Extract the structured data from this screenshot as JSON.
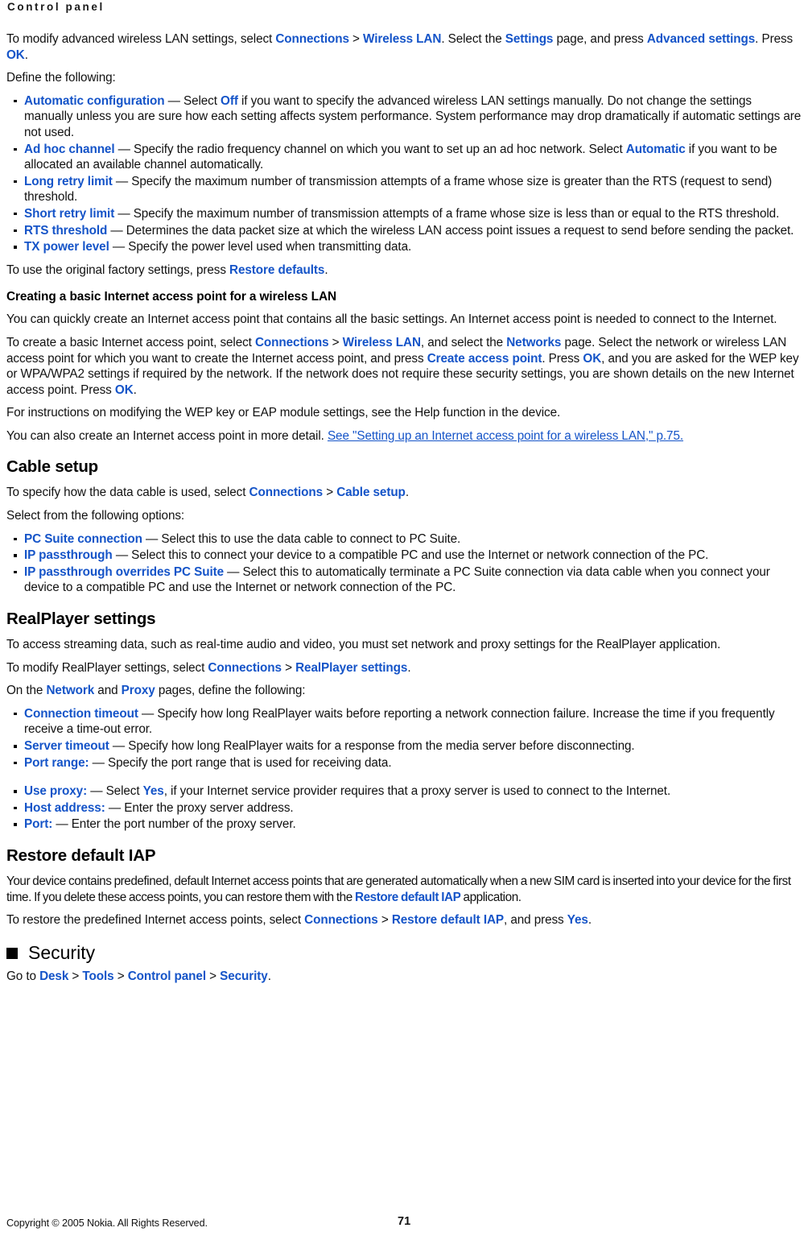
{
  "header": {
    "running_title": "Control panel"
  },
  "footer": {
    "copyright": "Copyright © 2005 Nokia. All Rights Reserved.",
    "page_number": "71"
  },
  "colors": {
    "ui_link": "#1554c8",
    "text": "#111111",
    "background": "#ffffff"
  },
  "content": {
    "intro": {
      "p1_a": "To modify advanced wireless LAN settings, select ",
      "p1_ui1": "Connections",
      "p1_b": " > ",
      "p1_ui2": "Wireless LAN",
      "p1_c": ". Select the ",
      "p1_ui3": "Settings",
      "p1_d": " page, and press ",
      "p1_ui4": "Advanced settings",
      "p1_e": ". Press ",
      "p1_ui5": "OK",
      "p1_f": ".",
      "p2": "Define the following:"
    },
    "wlan_bullets": [
      {
        "term": "Automatic configuration",
        "dash": " — ",
        "desc_a": "Select ",
        "ui": "Off",
        "desc_b": " if you want to specify the advanced wireless LAN settings manually. Do not change the settings manually unless you are sure how each setting affects system performance. System performance may drop dramatically if automatic settings are not used."
      },
      {
        "term": "Ad hoc channel",
        "dash": " — ",
        "desc_a": "Specify the radio frequency channel on which you want to set up an ad hoc network. Select ",
        "ui": "Automatic",
        "desc_b": " if you want to be allocated an available channel automatically."
      },
      {
        "term": "Long retry limit",
        "dash": " — ",
        "desc_a": "Specify the maximum number of transmission attempts of a frame whose size is greater than the RTS (request to send) threshold.",
        "ui": "",
        "desc_b": ""
      },
      {
        "term": "Short retry limit",
        "dash": " — ",
        "desc_a": "Specify the maximum number of transmission attempts of a frame whose size is less than or equal to the RTS threshold.",
        "ui": "",
        "desc_b": ""
      },
      {
        "term": "RTS threshold",
        "dash": " — ",
        "desc_a": "Determines the data packet size at which the wireless LAN access point issues a request to send before sending the packet.",
        "ui": "",
        "desc_b": ""
      },
      {
        "term": "TX power level",
        "dash": " — ",
        "desc_a": "Specify the power level used when transmitting data.",
        "ui": "",
        "desc_b": ""
      }
    ],
    "restore_defaults": {
      "a": "To use the original factory settings, press ",
      "ui": "Restore defaults",
      "b": "."
    },
    "basic_iap": {
      "heading": "Creating a basic Internet access point for a wireless LAN",
      "p1": "You can quickly create an Internet access point that contains all the basic settings. An Internet access point is needed to connect to the Internet.",
      "p2_a": "To create a basic Internet access point, select ",
      "p2_ui1": "Connections",
      "p2_b": " > ",
      "p2_ui2": "Wireless LAN",
      "p2_c": ", and select the ",
      "p2_ui3": "Networks",
      "p2_d": " page. Select the network or wireless LAN access point for which you want to create the Internet access point, and press ",
      "p2_ui4": "Create access point",
      "p2_e": ". Press ",
      "p2_ui5": "OK",
      "p2_f": ", and you are asked for the WEP key or WPA/WPA2 settings if required by the network. If the network does not require these security settings, you are shown details on the new Internet access point. Press ",
      "p2_ui6": "OK",
      "p2_g": ".",
      "p3": "For instructions on modifying the WEP key or EAP module settings, see the Help function in the device.",
      "p4_a": "You can also create an Internet access point in more detail. ",
      "p4_xref": "See \"Setting up an Internet access point for a wireless LAN,\" p.75."
    },
    "cable_setup": {
      "heading": "Cable setup",
      "p1_a": "To specify how the data cable is used, select ",
      "p1_ui1": "Connections",
      "p1_b": " > ",
      "p1_ui2": "Cable setup",
      "p1_c": ".",
      "p2": "Select from the following options:",
      "bullets": [
        {
          "term": "PC Suite connection",
          "dash": " — ",
          "desc": "Select this to use the data cable to connect to PC Suite."
        },
        {
          "term": "IP passthrough",
          "dash": " — ",
          "desc": "Select this to connect your device to a compatible PC and use the Internet or network connection of the PC."
        },
        {
          "term": "IP passthrough overrides PC Suite",
          "dash": " — ",
          "desc": "Select this to automatically terminate a PC Suite connection via data cable when you connect your device to a compatible PC and use the Internet or network connection of the PC."
        }
      ]
    },
    "realplayer": {
      "heading": "RealPlayer settings",
      "p1": "To access streaming data, such as real-time audio and video, you must set network and proxy settings for the RealPlayer application.",
      "p2_a": "To modify RealPlayer settings, select ",
      "p2_ui1": "Connections",
      "p2_b": " > ",
      "p2_ui2": "RealPlayer settings",
      "p2_c": ".",
      "p3_a": "On the ",
      "p3_ui1": "Network",
      "p3_b": " and ",
      "p3_ui2": "Proxy",
      "p3_c": " pages, define the following:",
      "network_bullets": [
        {
          "term": "Connection timeout",
          "dash": " — ",
          "desc_a": "Specify how long RealPlayer waits before reporting a network connection failure. Increase the time if you frequently receive a time-out error.",
          "ui": "",
          "desc_b": ""
        },
        {
          "term": "Server timeout",
          "dash": " — ",
          "desc_a": "Specify how long RealPlayer waits for a response from the media server before disconnecting.",
          "ui": "",
          "desc_b": ""
        },
        {
          "term": "Port range:",
          "dash": " — ",
          "desc_a": "Specify the port range that is used for receiving data.",
          "ui": "",
          "desc_b": ""
        }
      ],
      "proxy_bullets": [
        {
          "term": "Use proxy:",
          "dash": " — ",
          "desc_a": "Select ",
          "ui": "Yes",
          "desc_b": ", if your Internet service provider requires that a proxy server is used to connect to the Internet."
        },
        {
          "term": "Host address:",
          "dash": " — ",
          "desc_a": "Enter the proxy server address.",
          "ui": "",
          "desc_b": ""
        },
        {
          "term": "Port:",
          "dash": " — ",
          "desc_a": "Enter the port number of the proxy server.",
          "ui": "",
          "desc_b": ""
        }
      ]
    },
    "restore_iap": {
      "heading": "Restore default IAP",
      "p1_a": "Your device contains predefined, default Internet access points that are generated automatically when a new SIM card is inserted into your device for the first time. If you delete these access points, you can restore them with the ",
      "p1_ui": "Restore default IAP",
      "p1_b": " application.",
      "p2_a": "To restore the predefined Internet access points, select ",
      "p2_ui1": "Connections",
      "p2_b": " > ",
      "p2_ui2": "Restore default IAP",
      "p2_c": ", and press ",
      "p2_ui3": "Yes",
      "p2_d": "."
    },
    "security": {
      "heading": "Security",
      "p1_a": "Go to ",
      "p1_ui1": "Desk",
      "p1_b": " > ",
      "p1_ui2": "Tools",
      "p1_c": " > ",
      "p1_ui3": "Control panel",
      "p1_d": " > ",
      "p1_ui4": "Security",
      "p1_e": "."
    }
  }
}
